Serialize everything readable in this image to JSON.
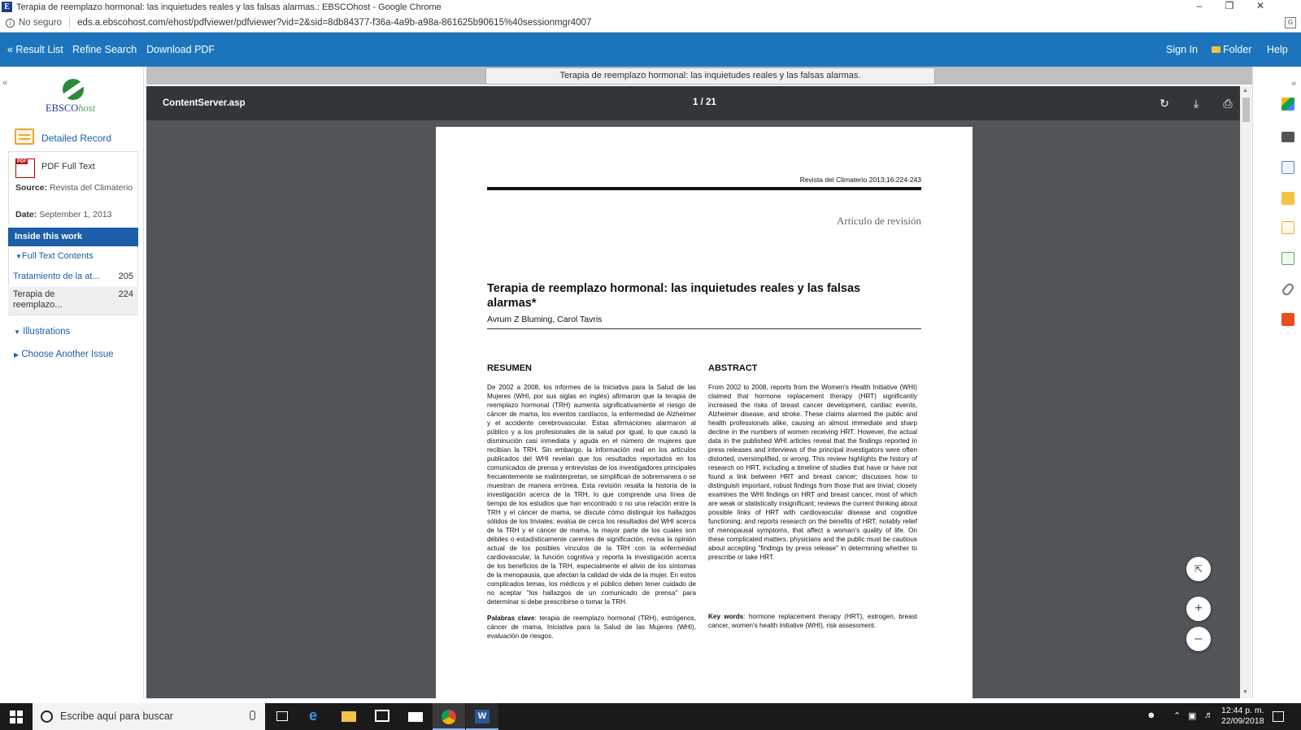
{
  "browser": {
    "window_title": "Terapia de reemplazo hormonal: las inquietudes reales y las falsas alarmas.: EBSCOhost - Google Chrome",
    "not_secure": "No seguro",
    "url": "eds.a.ebscohost.com/ehost/pdfviewer/pdfviewer?vid=2&sid=8db84377-f36a-4a9b-a98a-861625b90615%40sessionmgr4007"
  },
  "toolbar": {
    "result_list": "« Result List",
    "refine_search": "Refine Search",
    "download_pdf": "Download PDF",
    "sign_in": "Sign In",
    "folder": "Folder",
    "help": "Help"
  },
  "sidebar": {
    "logo_main": "EBSCO",
    "logo_sub": "host",
    "detailed_record": "Detailed Record",
    "pdf_full_text": "PDF Full Text",
    "source_label": "Source:",
    "source_value": "Revista del Climaterio",
    "date_label": "Date:",
    "date_value": "September 1, 2013",
    "inside_this_work": "Inside this work",
    "full_text_contents": "Full Text Contents",
    "toc": [
      {
        "title": "Tratamiento de la at...",
        "page": "205"
      },
      {
        "title": "Terapia de reemplazo...",
        "page": "224"
      }
    ],
    "illustrations": "Illustrations",
    "choose_another_issue": "Choose Another Issue"
  },
  "viewer": {
    "doc_tab": "Terapia de reemplazo hormonal: las inquietudes reales y las falsas alarmas.",
    "file_name": "ContentServer.asp",
    "page_indicator": "1  /  21"
  },
  "document": {
    "journal": "Revista del Climaterio 2013;16:224-243",
    "article_type": "Artículo de revisión",
    "title": "Terapia de reemplazo hormonal: las inquietudes reales y las falsas alarmas*",
    "authors": "Avrum Z Bluming, Carol Tavris",
    "resumen_heading": "RESUMEN",
    "resumen_text": "De 2002 a 2008, los informes de la Iniciativa para la Salud de las Mujeres (WHI, por sus siglas en inglés) afirmaron que la terapia de reemplazo hormonal (TRH) aumenta significativamente el riesgo de cáncer de mama, los eventos cardíacos, la enfermedad de Alzheimer y el accidente cerebrovascular. Estas afirmaciones alarmaron al público y a los profesionales de la salud por igual, lo que causó la disminución casi inmediata y aguda en el número de mujeres que recibían la TRH. Sin embargo, la información real en los artículos publicados del WHI revelan que los resultados reportados en los comunicados de prensa y entrevistas de los investigadores principales frecuentemente se malinterpretan, se simplifican de sobremanera o se muestran de manera errónea. Esta revisión resalta la historia de la investigación acerca de la TRH, lo que comprende una línea de tiempo de los estudios que han encontrado o no una relación entre la TRH y el cáncer de mama, se discute cómo distinguir los hallazgos sólidos de los triviales; evalúa de cerca los resultados del WHI acerca de la TRH y el cáncer de mama, la mayor parte de los cuales son débiles o estadísticamente carentes de significación, revisa la opinión actual de los posibles vínculos de la TRH con la enfermedad cardiovascular, la función cognitiva y reporta la investigación acerca de los beneficios de la TRH, especialmente el alivio de los síntomas de la menopausia, que afectan la calidad de vida de la mujer. En estos complicados temas, los médicos y el público deben tener cuidado de no aceptar \"los hallazgos de un comunicado de prensa\" para determinar si debe prescribirse o tomar la TRH.",
    "palabras_label": "Palabras clave",
    "palabras_text": ": terapia de reemplazo hormonal (TRH), estrógenos, cáncer de mama, Iniciativa para la Salud de las Mujeres (WHI), evaluación de riesgos.",
    "abstract_heading": "ABSTRACT",
    "abstract_text": "From 2002 to 2008, reports from the Women's Health Initiative (WHI) claimed that hormone replacement therapy (HRT) significantly increased the risks of breast cancer development, cardiac events, Alzheimer disease, and stroke. These claims alarmed the public and health professionals alike, causing an almost immediate and sharp decline in the numbers of women receiving HRT. However, the actual data in the published WHI articles reveal that the findings reported in press releases and interviews of the principal investigators were often distorted, oversimplified, or wrong. This review highlights the history of research on HRT, including a timeline of studies that have or have not found a link between HRT and breast cancer; discusses how to distinguish important, robust findings from those that are trivial; closely examines the WHI findings on HRT and breast cancer, most of which are weak or statistically insignificant; reviews the current thinking about possible links of HRT with cardiovascular disease and cognitive functioning; and reports research on the benefits of HRT, notably relief of menopausal symptoms, that affect a woman's quality of life. On these complicated matters, physicians and the public must be cautious about accepting \"findings by press release\" in determining whether to prescribe or take HRT.",
    "keywords_label": "Key words",
    "keywords_text": ": hormone replacement therapy (HRT), estrogen, breast cancer, women's health initiative (WHI), risk assessment."
  },
  "taskbar": {
    "search_placeholder": "Escribe aquí para buscar",
    "time": "12:44 p. m.",
    "date": "22/09/2018"
  },
  "colors": {
    "ebsco_blue": "#1c75bc",
    "link_blue": "#1d5ea8",
    "viewer_bg": "#525659",
    "viewer_toolbar": "#323639"
  }
}
